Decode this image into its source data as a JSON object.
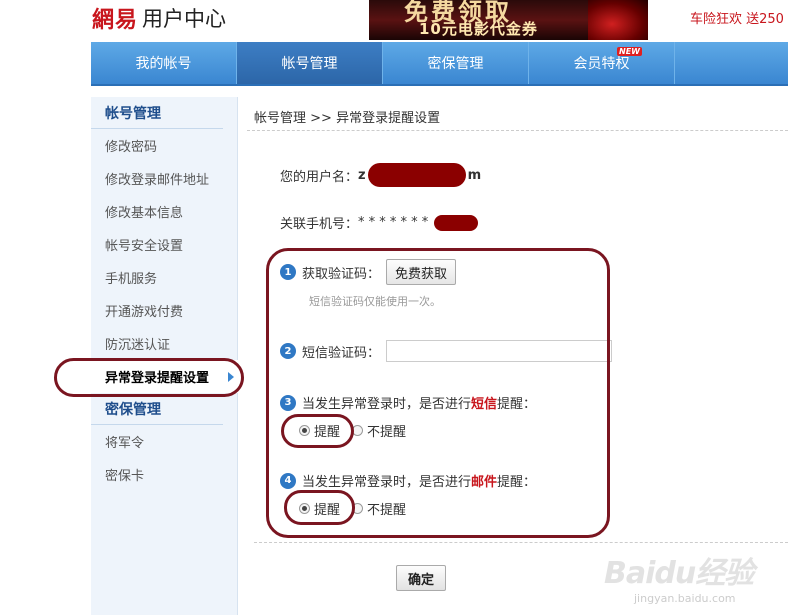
{
  "header": {
    "brand": "網易",
    "title": "用户中心",
    "banner_line1": "免费领取",
    "banner_line2": "10元电影代金券",
    "promo": "车险狂欢 送250"
  },
  "nav": {
    "items": [
      {
        "label": "我的帐号"
      },
      {
        "label": "帐号管理"
      },
      {
        "label": "密保管理"
      },
      {
        "label": "会员特权"
      }
    ],
    "new_badge": "NEW"
  },
  "sidebar": {
    "section1": "帐号管理",
    "items1": [
      {
        "label": "修改密码"
      },
      {
        "label": "修改登录邮件地址"
      },
      {
        "label": "修改基本信息"
      },
      {
        "label": "帐号安全设置"
      },
      {
        "label": "手机服务"
      },
      {
        "label": "开通游戏付费"
      },
      {
        "label": "防沉迷认证"
      },
      {
        "label": "异常登录提醒设置"
      }
    ],
    "section2": "密保管理",
    "items2": [
      {
        "label": "将军令"
      },
      {
        "label": "密保卡"
      }
    ]
  },
  "breadcrumb": {
    "parent": "帐号管理",
    "sep": ">>",
    "current": "异常登录提醒设置"
  },
  "form": {
    "username_label": "您的用户名：",
    "username_prefix": "z",
    "username_suffix": "m",
    "phone_label": "关联手机号：",
    "phone_mask": "* * * * * * *",
    "step1_num": "1",
    "step1_label": "获取验证码：",
    "free_button": "免费获取",
    "hint": "短信验证码仅能使用一次。",
    "step2_num": "2",
    "step2_label": "短信验证码：",
    "sms_value": "",
    "step3_num": "3",
    "step3_pre": "当发生异常登录时，是否进行",
    "step3_key": "短信",
    "step3_post": "提醒：",
    "step4_num": "4",
    "step4_pre": "当发生异常登录时，是否进行",
    "step4_key": "邮件",
    "step4_post": "提醒：",
    "remind": "提醒",
    "no_remind": "不提醒",
    "confirm": "确定"
  },
  "watermark": {
    "line1": "Baidu经验",
    "line2": "jingyan.baidu.com"
  },
  "colors": {
    "nav_blue": "#3a86d1",
    "brand_red": "#c8161d",
    "annotation": "#7a1520"
  }
}
